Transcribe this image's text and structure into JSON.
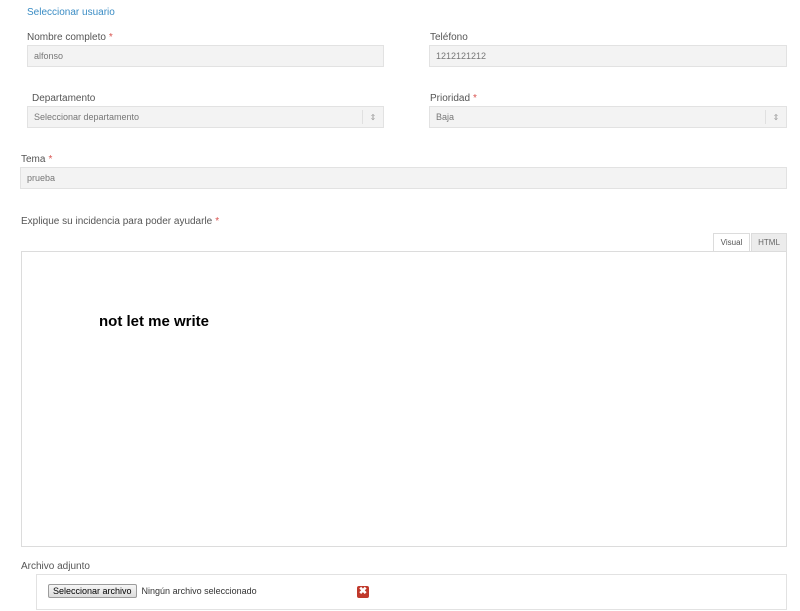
{
  "select_user_link": "Seleccionar usuario",
  "full_name": {
    "label": "Nombre completo",
    "value": "alfonso",
    "required_mark": "*"
  },
  "phone": {
    "label": "Teléfono",
    "value": "1212121212"
  },
  "department": {
    "label": "Departamento",
    "value": "Seleccionar departamento",
    "arrows": "⇕"
  },
  "priority": {
    "label": "Prioridad",
    "value": "Baja",
    "required_mark": "*",
    "arrows": "⇕"
  },
  "subject": {
    "label": "Tema",
    "value": "prueba",
    "required_mark": "*"
  },
  "description": {
    "label": "Explique su incidencia para poder ayudarle",
    "required_mark": "*",
    "tabs": [
      "Visual",
      "HTML"
    ],
    "content": "not let me write"
  },
  "attachment": {
    "label": "Archivo adjunto",
    "button_label": "Seleccionar archivo",
    "status": "Ningún archivo seleccionado",
    "remove_symbol": "✖"
  }
}
